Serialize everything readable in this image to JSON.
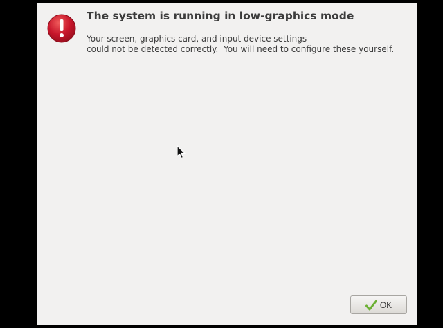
{
  "dialog": {
    "title": "The system is running in low-graphics mode",
    "message": "Your screen, graphics card, and input device settings\ncould not be detected correctly.  You will need to configure these yourself.",
    "icon": "error-icon",
    "ok_button": {
      "label": "OK",
      "icon": "checkmark-icon"
    }
  },
  "colors": {
    "screen_background": "#000000",
    "dialog_background": "#f2f1f0",
    "error_red": "#c7162b",
    "checkmark_green": "#6bb033"
  }
}
